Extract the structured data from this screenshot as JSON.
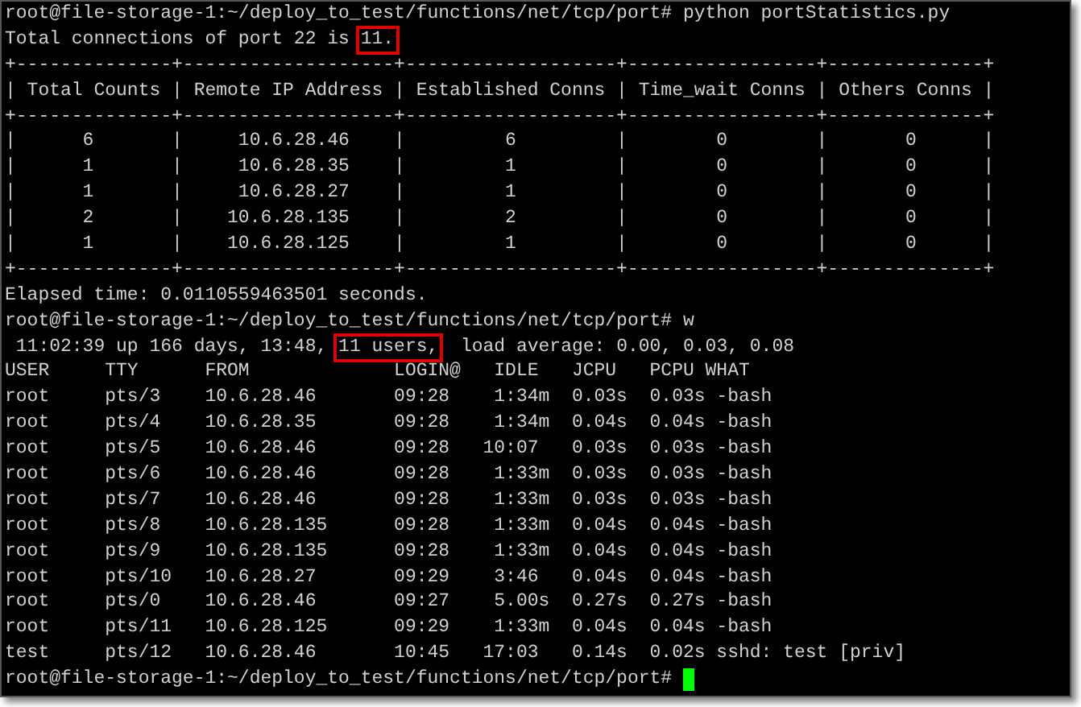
{
  "terminal": {
    "lines": [
      {
        "kind": "text",
        "text": "root@file-storage-1:~/deploy_to_test/functions/net/tcp/port# python portStatistics.py"
      },
      {
        "kind": "marked",
        "segments": [
          {
            "text": "Total connections of port 22 is ",
            "boxed": false
          },
          {
            "text": "11.",
            "boxed": true
          }
        ]
      },
      {
        "kind": "text",
        "text": "+--------------+-------------------+-------------------+-----------------+--------------+"
      },
      {
        "kind": "text",
        "text": "| Total Counts | Remote IP Address | Established Conns | Time_wait Conns | Others Conns |"
      },
      {
        "kind": "text",
        "text": "+--------------+-------------------+-------------------+-----------------+--------------+"
      },
      {
        "kind": "text",
        "text": "|      6       |     10.6.28.46    |         6         |        0        |       0      |"
      },
      {
        "kind": "text",
        "text": "|      1       |     10.6.28.35    |         1         |        0        |       0      |"
      },
      {
        "kind": "text",
        "text": "|      1       |     10.6.28.27    |         1         |        0        |       0      |"
      },
      {
        "kind": "text",
        "text": "|      2       |    10.6.28.135    |         2         |        0        |       0      |"
      },
      {
        "kind": "text",
        "text": "|      1       |    10.6.28.125    |         1         |        0        |       0      |"
      },
      {
        "kind": "text",
        "text": "+--------------+-------------------+-------------------+-----------------+--------------+"
      },
      {
        "kind": "text",
        "text": "Elapsed time: 0.0110559463501 seconds."
      },
      {
        "kind": "text",
        "text": "root@file-storage-1:~/deploy_to_test/functions/net/tcp/port# w"
      },
      {
        "kind": "marked",
        "segments": [
          {
            "text": " 11:02:39 up 166 days, 13:48, ",
            "boxed": false
          },
          {
            "text": "11 users,",
            "boxed": true
          },
          {
            "text": "  load average: 0.00, 0.03, 0.08",
            "boxed": false
          }
        ]
      },
      {
        "kind": "text",
        "text": "USER     TTY      FROM             LOGIN@   IDLE   JCPU   PCPU WHAT"
      },
      {
        "kind": "text",
        "text": "root     pts/3    10.6.28.46       09:28    1:34m  0.03s  0.03s -bash"
      },
      {
        "kind": "text",
        "text": "root     pts/4    10.6.28.35       09:28    1:34m  0.04s  0.04s -bash"
      },
      {
        "kind": "text",
        "text": "root     pts/5    10.6.28.46       09:28   10:07   0.03s  0.03s -bash"
      },
      {
        "kind": "text",
        "text": "root     pts/6    10.6.28.46       09:28    1:33m  0.03s  0.03s -bash"
      },
      {
        "kind": "text",
        "text": "root     pts/7    10.6.28.46       09:28    1:33m  0.03s  0.03s -bash"
      },
      {
        "kind": "text",
        "text": "root     pts/8    10.6.28.135      09:28    1:33m  0.04s  0.04s -bash"
      },
      {
        "kind": "text",
        "text": "root     pts/9    10.6.28.135      09:28    1:33m  0.04s  0.04s -bash"
      },
      {
        "kind": "text",
        "text": "root     pts/10   10.6.28.27       09:29    3:46   0.04s  0.04s -bash"
      },
      {
        "kind": "text",
        "text": "root     pts/0    10.6.28.46       09:27    5.00s  0.27s  0.27s -bash"
      },
      {
        "kind": "text",
        "text": "root     pts/11   10.6.28.125      09:29    1:33m  0.04s  0.04s -bash"
      },
      {
        "kind": "text",
        "text": "test     pts/12   10.6.28.46       10:45   17:03   0.14s  0.02s sshd: test [priv]"
      },
      {
        "kind": "cursor_line",
        "text": "root@file-storage-1:~/deploy_to_test/functions/net/tcp/port# "
      }
    ]
  }
}
